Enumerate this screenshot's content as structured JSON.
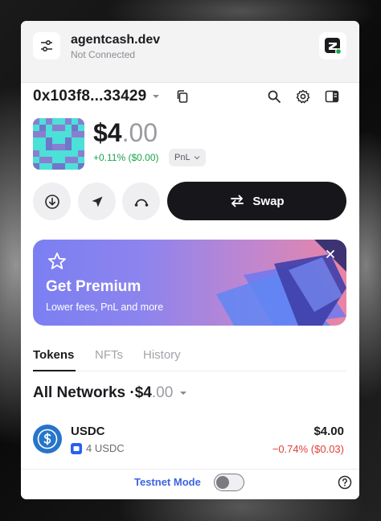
{
  "header": {
    "site_name": "agentcash.dev",
    "site_status": "Not Connected"
  },
  "wallet": {
    "address": "0x103f8...33429",
    "balance_main": "$4",
    "balance_cents": ".00",
    "change_text": "+0.11% ($0.00)",
    "pnl_label": "PnL"
  },
  "actions": {
    "swap_label": "Swap"
  },
  "promo": {
    "title": "Get Premium",
    "subtitle": "Lower fees, PnL and more"
  },
  "tabs": [
    {
      "label": "Tokens",
      "active": true
    },
    {
      "label": "NFTs",
      "active": false
    },
    {
      "label": "History",
      "active": false
    }
  ],
  "networks": {
    "label": "All Networks",
    "sep": "·",
    "total_main": "$4",
    "total_cents": ".00"
  },
  "tokens": [
    {
      "name": "USDC",
      "amount": "4 USDC",
      "value": "$4.00",
      "change": "−0.74% ($0.03)"
    }
  ],
  "footer": {
    "testnet_label": "Testnet Mode",
    "testnet_enabled": false
  },
  "colors": {
    "accent": "#3c63e3",
    "positive": "#1aa34a",
    "negative": "#e0413a",
    "dark": "#17171b",
    "usdc": "#2775ca"
  },
  "icons": {
    "settings": "sliders-icon",
    "brand": "agentcash-logo-icon",
    "copy": "copy-icon",
    "search": "search-icon",
    "gear": "gear-icon",
    "panel": "side-panel-icon",
    "receive": "download-icon",
    "send": "send-icon",
    "bridge": "bridge-icon",
    "swap": "swap-arrows-icon",
    "star": "star-icon",
    "close": "close-icon",
    "help": "help-icon"
  }
}
